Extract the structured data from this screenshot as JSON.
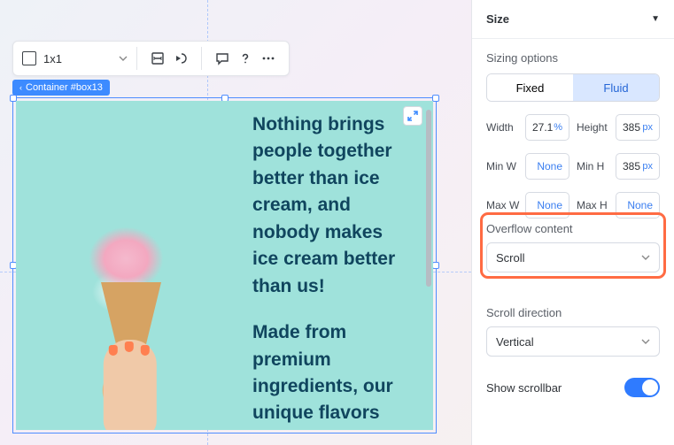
{
  "toolbar": {
    "ratio_label": "1x1",
    "icons": [
      "fit-width-icon",
      "rotate-icon",
      "comment-icon",
      "help-icon",
      "more-icon"
    ]
  },
  "selection_badge": {
    "label": "Container #box13"
  },
  "content": {
    "paragraph1": "Nothing brings people together better than ice cream, and nobody makes ice cream better than us!",
    "paragraph2": "Made from premium ingredients, our unique flavors"
  },
  "panel": {
    "section_title": "Size",
    "sizing_options_label": "Sizing options",
    "sizing_options": {
      "fixed": "Fixed",
      "fluid": "Fluid",
      "active": "fluid"
    },
    "width": {
      "label": "Width",
      "value": "27.1",
      "unit": "%"
    },
    "height": {
      "label": "Height",
      "value": "385",
      "unit": "px"
    },
    "minw": {
      "label": "Min W",
      "value": "None"
    },
    "minh": {
      "label": "Min H",
      "value": "385",
      "unit": "px"
    },
    "maxw": {
      "label": "Max W",
      "value": "None"
    },
    "maxh": {
      "label": "Max H",
      "value": "None"
    },
    "overflow_label": "Overflow content",
    "overflow_value": "Scroll",
    "scrolldir_label": "Scroll direction",
    "scrolldir_value": "Vertical",
    "show_scrollbar_label": "Show scrollbar",
    "show_scrollbar_on": true
  }
}
